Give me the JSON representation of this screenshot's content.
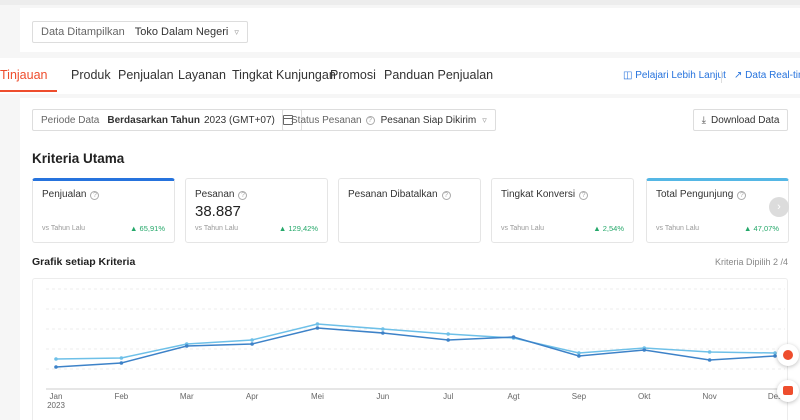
{
  "filter": {
    "label": "Data Ditampilkan",
    "value": "Toko Dalam Negeri"
  },
  "nav": {
    "tabs": [
      {
        "label": "Tinjauan",
        "active": true
      },
      {
        "label": "Produk"
      },
      {
        "label": "Penjualan"
      },
      {
        "label": "Layanan"
      },
      {
        "label": "Tingkat Kunjungan"
      },
      {
        "label": "Promosi"
      },
      {
        "label": "Panduan Penjualan"
      }
    ],
    "learn_more": "Pelajari Lebih Lanjut",
    "realtime": "Data Real-tim"
  },
  "period": {
    "label": "Periode Data",
    "type": "Berdasarkan Tahun",
    "value": "2023 (GMT+07)"
  },
  "status": {
    "label": "Status Pesanan",
    "value": "Pesanan Siap Dikirim"
  },
  "download_label": "Download Data",
  "section_title": "Kriteria Utama",
  "cards": [
    {
      "title": "Penjualan",
      "value": "",
      "compare": "vs Tahun Lalu",
      "pct": "▲ 65,91%",
      "selected": "blue"
    },
    {
      "title": "Pesanan",
      "value": "38.887",
      "compare": "vs Tahun Lalu",
      "pct": "▲ 129,42%"
    },
    {
      "title": "Pesanan Dibatalkan",
      "value": "",
      "compare": "",
      "pct": ""
    },
    {
      "title": "Tingkat Konversi",
      "value": "",
      "compare": "vs Tahun Lalu",
      "pct": "▲ 2,54%"
    },
    {
      "title": "Total Pengunjung",
      "value": "",
      "compare": "vs Tahun Lalu",
      "pct": "▲ 47,07%",
      "selected": "lightblue"
    }
  ],
  "chart_title": "Grafik setiap Kriteria",
  "chart_selected": "Kriteria Dipilih 2 /4",
  "colors": {
    "accent": "#ee4d2d",
    "link": "#2673dd",
    "series_dark": "#3d82c8",
    "series_light": "#6ec0e8",
    "positive": "#25a86a"
  },
  "chart_data": {
    "type": "line",
    "categories": [
      "Jan",
      "Feb",
      "Mar",
      "Apr",
      "Mei",
      "Jun",
      "Jul",
      "Agt",
      "Sep",
      "Okt",
      "Nov",
      "Des"
    ],
    "year_label": "2023",
    "series": [
      {
        "color": "#3d82c8",
        "values": [
          22,
          26,
          43,
          45,
          61,
          56,
          49,
          52,
          33,
          39,
          29,
          33
        ]
      },
      {
        "color": "#6ec0e8",
        "values": [
          30,
          31,
          45,
          49,
          65,
          60,
          55,
          51,
          36,
          41,
          37,
          36
        ]
      }
    ],
    "ylim": [
      0,
      100
    ],
    "grid": true
  }
}
